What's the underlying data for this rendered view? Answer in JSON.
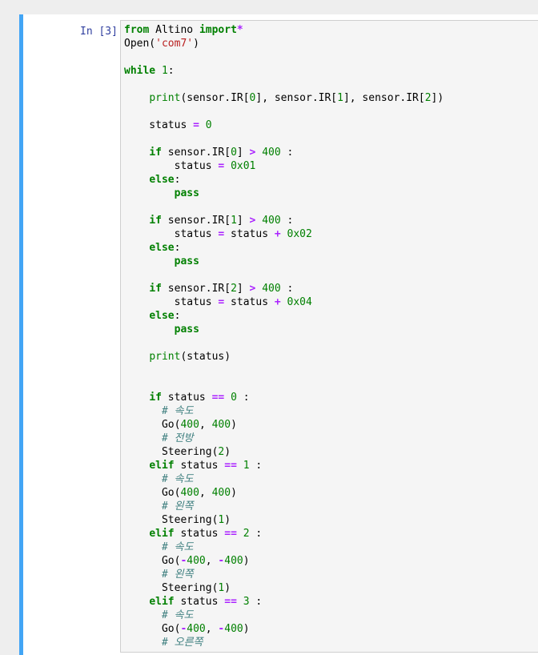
{
  "cell": {
    "prompt": "In [3]:",
    "lines": [
      [
        {
          "t": "from",
          "c": "kw"
        },
        {
          "t": " Altino "
        },
        {
          "t": "import",
          "c": "kw"
        },
        {
          "t": "*",
          "c": "op"
        }
      ],
      [
        {
          "t": "Open("
        },
        {
          "t": "'com7'",
          "c": "str"
        },
        {
          "t": ")"
        }
      ],
      [],
      [
        {
          "t": "while",
          "c": "kw"
        },
        {
          "t": " "
        },
        {
          "t": "1",
          "c": "num"
        },
        {
          "t": ":"
        }
      ],
      [],
      [
        {
          "t": "    "
        },
        {
          "t": "print",
          "c": "bi"
        },
        {
          "t": "(sensor.IR["
        },
        {
          "t": "0",
          "c": "num"
        },
        {
          "t": "], sensor.IR["
        },
        {
          "t": "1",
          "c": "num"
        },
        {
          "t": "], sensor.IR["
        },
        {
          "t": "2",
          "c": "num"
        },
        {
          "t": "])"
        }
      ],
      [],
      [
        {
          "t": "    status "
        },
        {
          "t": "=",
          "c": "op"
        },
        {
          "t": " "
        },
        {
          "t": "0",
          "c": "num"
        }
      ],
      [],
      [
        {
          "t": "    "
        },
        {
          "t": "if",
          "c": "kw"
        },
        {
          "t": " sensor.IR["
        },
        {
          "t": "0",
          "c": "num"
        },
        {
          "t": "] "
        },
        {
          "t": ">",
          "c": "op"
        },
        {
          "t": " "
        },
        {
          "t": "400",
          "c": "num"
        },
        {
          "t": " :"
        }
      ],
      [
        {
          "t": "        status "
        },
        {
          "t": "=",
          "c": "op"
        },
        {
          "t": " "
        },
        {
          "t": "0x01",
          "c": "num"
        }
      ],
      [
        {
          "t": "    "
        },
        {
          "t": "else",
          "c": "kw"
        },
        {
          "t": ":"
        }
      ],
      [
        {
          "t": "        "
        },
        {
          "t": "pass",
          "c": "kw"
        }
      ],
      [],
      [
        {
          "t": "    "
        },
        {
          "t": "if",
          "c": "kw"
        },
        {
          "t": " sensor.IR["
        },
        {
          "t": "1",
          "c": "num"
        },
        {
          "t": "] "
        },
        {
          "t": ">",
          "c": "op"
        },
        {
          "t": " "
        },
        {
          "t": "400",
          "c": "num"
        },
        {
          "t": " :"
        }
      ],
      [
        {
          "t": "        status "
        },
        {
          "t": "=",
          "c": "op"
        },
        {
          "t": " status "
        },
        {
          "t": "+",
          "c": "op"
        },
        {
          "t": " "
        },
        {
          "t": "0x02",
          "c": "num"
        }
      ],
      [
        {
          "t": "    "
        },
        {
          "t": "else",
          "c": "kw"
        },
        {
          "t": ":"
        }
      ],
      [
        {
          "t": "        "
        },
        {
          "t": "pass",
          "c": "kw"
        }
      ],
      [],
      [
        {
          "t": "    "
        },
        {
          "t": "if",
          "c": "kw"
        },
        {
          "t": " sensor.IR["
        },
        {
          "t": "2",
          "c": "num"
        },
        {
          "t": "] "
        },
        {
          "t": ">",
          "c": "op"
        },
        {
          "t": " "
        },
        {
          "t": "400",
          "c": "num"
        },
        {
          "t": " :"
        }
      ],
      [
        {
          "t": "        status "
        },
        {
          "t": "=",
          "c": "op"
        },
        {
          "t": " status "
        },
        {
          "t": "+",
          "c": "op"
        },
        {
          "t": " "
        },
        {
          "t": "0x04",
          "c": "num"
        }
      ],
      [
        {
          "t": "    "
        },
        {
          "t": "else",
          "c": "kw"
        },
        {
          "t": ":"
        }
      ],
      [
        {
          "t": "        "
        },
        {
          "t": "pass",
          "c": "kw"
        }
      ],
      [],
      [
        {
          "t": "    "
        },
        {
          "t": "print",
          "c": "bi"
        },
        {
          "t": "(status)"
        }
      ],
      [],
      [],
      [
        {
          "t": "    "
        },
        {
          "t": "if",
          "c": "kw"
        },
        {
          "t": " status "
        },
        {
          "t": "==",
          "c": "op"
        },
        {
          "t": " "
        },
        {
          "t": "0",
          "c": "num"
        },
        {
          "t": " :"
        }
      ],
      [
        {
          "t": "      "
        },
        {
          "t": "# 속도",
          "c": "cm"
        }
      ],
      [
        {
          "t": "      Go("
        },
        {
          "t": "400",
          "c": "num"
        },
        {
          "t": ", "
        },
        {
          "t": "400",
          "c": "num"
        },
        {
          "t": ")"
        }
      ],
      [
        {
          "t": "      "
        },
        {
          "t": "# 전방",
          "c": "cm"
        }
      ],
      [
        {
          "t": "      Steering("
        },
        {
          "t": "2",
          "c": "num"
        },
        {
          "t": ")"
        }
      ],
      [
        {
          "t": "    "
        },
        {
          "t": "elif",
          "c": "kw"
        },
        {
          "t": " status "
        },
        {
          "t": "==",
          "c": "op"
        },
        {
          "t": " "
        },
        {
          "t": "1",
          "c": "num"
        },
        {
          "t": " :"
        }
      ],
      [
        {
          "t": "      "
        },
        {
          "t": "# 속도",
          "c": "cm"
        }
      ],
      [
        {
          "t": "      Go("
        },
        {
          "t": "400",
          "c": "num"
        },
        {
          "t": ", "
        },
        {
          "t": "400",
          "c": "num"
        },
        {
          "t": ")"
        }
      ],
      [
        {
          "t": "      "
        },
        {
          "t": "# 왼쪽",
          "c": "cm"
        }
      ],
      [
        {
          "t": "      Steering("
        },
        {
          "t": "1",
          "c": "num"
        },
        {
          "t": ")"
        }
      ],
      [
        {
          "t": "    "
        },
        {
          "t": "elif",
          "c": "kw"
        },
        {
          "t": " status "
        },
        {
          "t": "==",
          "c": "op"
        },
        {
          "t": " "
        },
        {
          "t": "2",
          "c": "num"
        },
        {
          "t": " :"
        }
      ],
      [
        {
          "t": "      "
        },
        {
          "t": "# 속도",
          "c": "cm"
        }
      ],
      [
        {
          "t": "      Go("
        },
        {
          "t": "-",
          "c": "op"
        },
        {
          "t": "400",
          "c": "num"
        },
        {
          "t": ", "
        },
        {
          "t": "-",
          "c": "op"
        },
        {
          "t": "400",
          "c": "num"
        },
        {
          "t": ")"
        }
      ],
      [
        {
          "t": "      "
        },
        {
          "t": "# 왼쪽",
          "c": "cm"
        }
      ],
      [
        {
          "t": "      Steering("
        },
        {
          "t": "1",
          "c": "num"
        },
        {
          "t": ")"
        }
      ],
      [
        {
          "t": "    "
        },
        {
          "t": "elif",
          "c": "kw"
        },
        {
          "t": " status "
        },
        {
          "t": "==",
          "c": "op"
        },
        {
          "t": " "
        },
        {
          "t": "3",
          "c": "num"
        },
        {
          "t": " :"
        }
      ],
      [
        {
          "t": "      "
        },
        {
          "t": "# 속도",
          "c": "cm"
        }
      ],
      [
        {
          "t": "      Go("
        },
        {
          "t": "-",
          "c": "op"
        },
        {
          "t": "400",
          "c": "num"
        },
        {
          "t": ", "
        },
        {
          "t": "-",
          "c": "op"
        },
        {
          "t": "400",
          "c": "num"
        },
        {
          "t": ")"
        }
      ],
      [
        {
          "t": "      "
        },
        {
          "t": "# 오른쪽",
          "c": "cm"
        }
      ]
    ]
  }
}
